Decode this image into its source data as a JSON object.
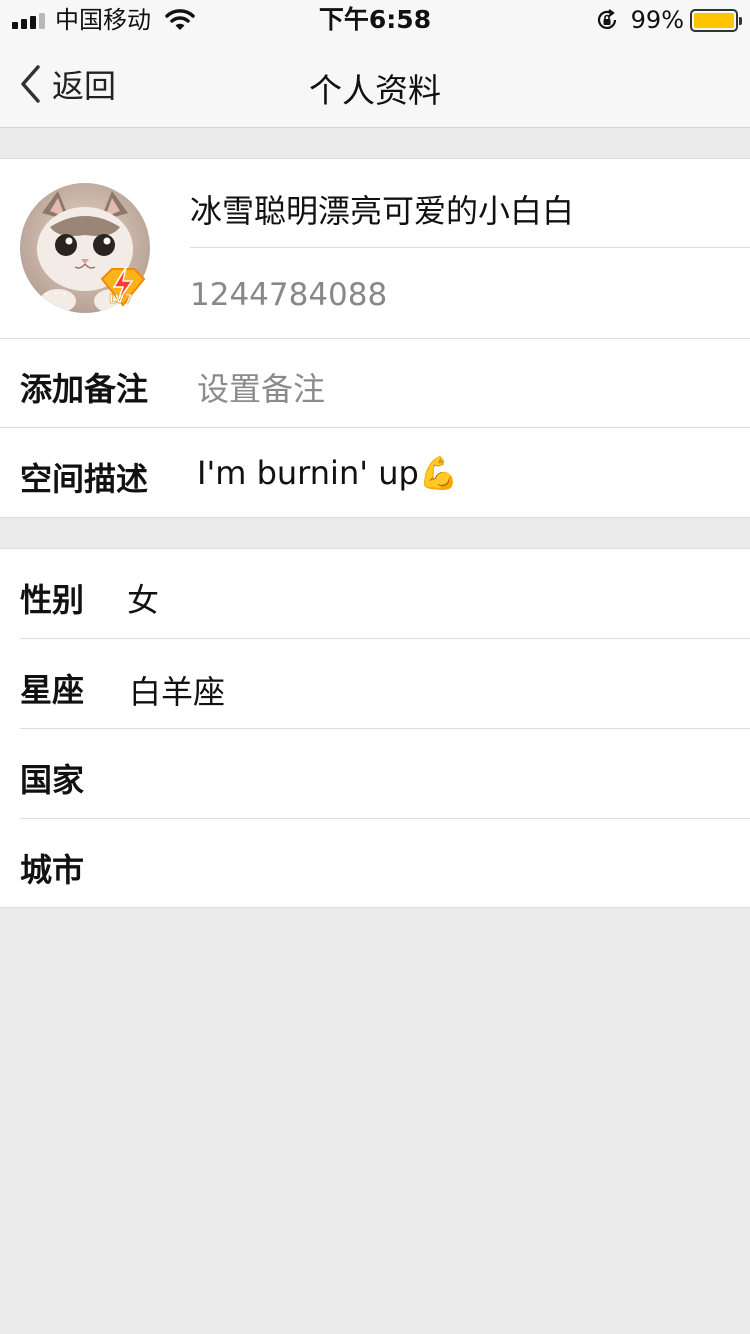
{
  "status_bar": {
    "carrier": "中国移动",
    "time": "下午6:58",
    "battery_percent": "99%",
    "battery_level": 0.99,
    "icons": [
      "signal-icon",
      "wifi-icon",
      "rotation-lock-icon",
      "battery-icon"
    ]
  },
  "nav": {
    "back_label": "返回",
    "title": "个人资料"
  },
  "profile": {
    "nickname": "冰雪聪明漂亮可爱的小白白",
    "qq_number": "1244784088",
    "level_badge": "LV7",
    "remark_label": "添加备注",
    "remark_placeholder": "设置备注",
    "description_label": "空间描述",
    "description_value": "I'm burnin' up💪"
  },
  "basic_info": {
    "gender_label": "性别",
    "gender_value": "女",
    "zodiac_label": "星座",
    "zodiac_value": "白羊座",
    "country_label": "国家",
    "country_value": "",
    "city_label": "城市",
    "city_value": ""
  },
  "colors": {
    "background": "#ebebeb",
    "bar": "#f7f7f7",
    "battery": "#ffc500",
    "secondary_text": "#888888"
  }
}
